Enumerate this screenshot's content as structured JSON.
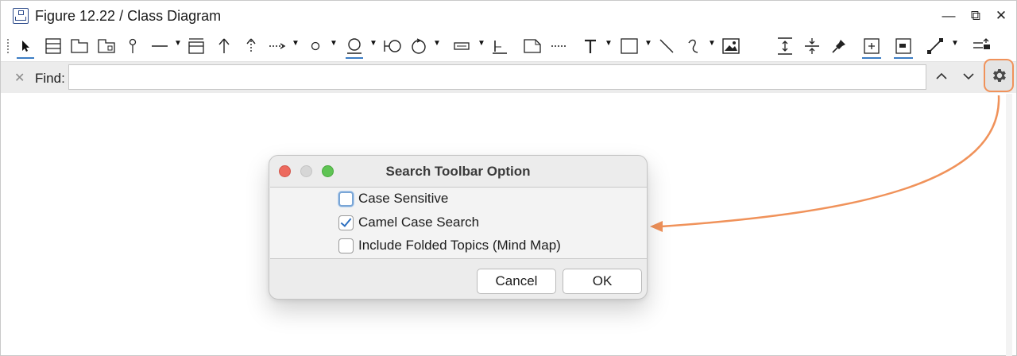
{
  "window": {
    "title": "Figure 12.22 / Class Diagram",
    "controls": {
      "minimize": "—",
      "restore": "⧉",
      "close": "✕"
    }
  },
  "toolbar": {
    "tools": [
      "select-tool",
      "class-tool",
      "package-tool",
      "subsystem-tool",
      "containment-tool",
      "association-tool",
      "interface-tool",
      "generalization-tool",
      "realization-tool",
      "dependency-tool",
      "port-tool",
      "actor-tool",
      "boundary-tool",
      "control-tool",
      "containment-box-tool",
      "note-tool",
      "anchor-tool",
      "text-tool",
      "rectangle-tool",
      "line-tool",
      "freehand-tool",
      "image-tool",
      "align-tool",
      "distribute-tool",
      "pin-tool",
      "auto-fit-tool",
      "group-tool",
      "connector-style-tool",
      "layer-tool"
    ]
  },
  "findbar": {
    "label": "Find:",
    "value": "",
    "close_icon": "close-icon",
    "prev_icon": "chevron-up-icon",
    "next_icon": "chevron-down-icon",
    "options_icon": "gear-icon"
  },
  "dialog": {
    "title": "Search Toolbar Option",
    "options": [
      {
        "label": "Case Sensitive",
        "checked": false
      },
      {
        "label": "Camel Case Search",
        "checked": true
      },
      {
        "label": "Include Folded Topics (Mind Map)",
        "checked": false
      }
    ],
    "cancel_label": "Cancel",
    "ok_label": "OK"
  },
  "colors": {
    "accent_orange": "#f0925a",
    "checkmark_blue": "#2c6fc0",
    "underline_blue": "#3c7dc4"
  }
}
